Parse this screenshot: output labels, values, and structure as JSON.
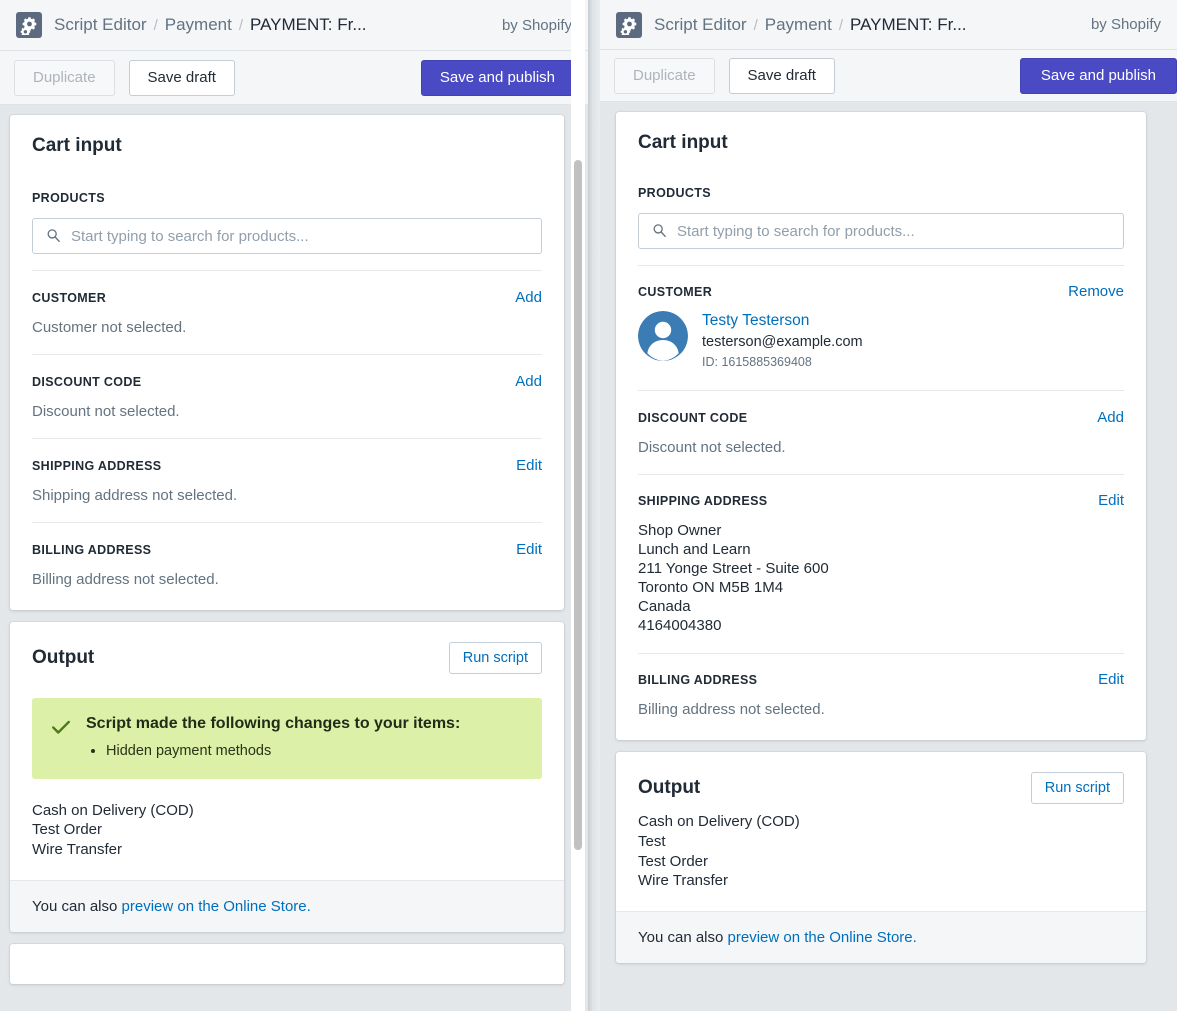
{
  "left": {
    "topbar": {
      "app_icon": "gears-icon",
      "breadcrumb_app": "Script Editor",
      "breadcrumb_sep": "/",
      "breadcrumb_section": "Payment",
      "breadcrumb_current": "PAYMENT: Fr...",
      "by_line": "by Shopify"
    },
    "actions": {
      "duplicate": "Duplicate",
      "save_draft": "Save draft",
      "save_publish": "Save and publish"
    },
    "cart_input": {
      "title": "Cart input",
      "products_label": "PRODUCTS",
      "products_placeholder": "Start typing to search for products...",
      "customer_label": "CUSTOMER",
      "customer_action": "Add",
      "customer_value": "Customer not selected.",
      "discount_label": "DISCOUNT CODE",
      "discount_action": "Add",
      "discount_value": "Discount not selected.",
      "shipping_label": "SHIPPING ADDRESS",
      "shipping_action": "Edit",
      "shipping_value": "Shipping address not selected.",
      "billing_label": "BILLING ADDRESS",
      "billing_action": "Edit",
      "billing_value": "Billing address not selected."
    },
    "output": {
      "title": "Output",
      "run_button": "Run script",
      "banner_title": "Script made the following changes to your items:",
      "banner_items": [
        "Hidden payment methods"
      ],
      "banner_icon": "check-icon",
      "payment_methods": [
        "Cash on Delivery (COD)",
        "Test Order",
        "Wire Transfer"
      ],
      "footer_prefix": "You can also ",
      "footer_link": "preview on the Online Store."
    }
  },
  "right": {
    "topbar": {
      "app_icon": "gears-icon",
      "breadcrumb_app": "Script Editor",
      "breadcrumb_sep": "/",
      "breadcrumb_section": "Payment",
      "breadcrumb_current": "PAYMENT: Fr...",
      "by_line": "by Shopify"
    },
    "actions": {
      "duplicate": "Duplicate",
      "save_draft": "Save draft",
      "save_publish": "Save and publish"
    },
    "cart_input": {
      "title": "Cart input",
      "products_label": "PRODUCTS",
      "products_placeholder": "Start typing to search for products...",
      "customer_label": "CUSTOMER",
      "customer_action": "Remove",
      "customer_name": "Testy Testerson",
      "customer_email": "testerson@example.com",
      "customer_id": "ID: 1615885369408",
      "customer_avatar": "person-avatar-icon",
      "discount_label": "DISCOUNT CODE",
      "discount_action": "Add",
      "discount_value": "Discount not selected.",
      "shipping_label": "SHIPPING ADDRESS",
      "shipping_action": "Edit",
      "shipping_lines": [
        "Shop Owner",
        "Lunch and Learn",
        "211 Yonge Street - Suite 600",
        "Toronto ON M5B 1M4",
        "Canada",
        "4164004380"
      ],
      "billing_label": "BILLING ADDRESS",
      "billing_action": "Edit",
      "billing_value": "Billing address not selected."
    },
    "output": {
      "title": "Output",
      "run_button": "Run script",
      "payment_methods": [
        "Cash on Delivery (COD)",
        "Test",
        "Test Order",
        "Wire Transfer"
      ],
      "footer_prefix": "You can also ",
      "footer_link": "preview on the Online Store."
    }
  },
  "colors": {
    "primary_button": "#4a4ac4",
    "link": "#006fbb",
    "banner_success_bg": "#dcf0a8",
    "banner_success_icon": "#4a7a18",
    "avatar_blue": "#3b7cb5",
    "app_icon_bg": "#5c6a80",
    "page_bg": "#e3e7ea"
  }
}
